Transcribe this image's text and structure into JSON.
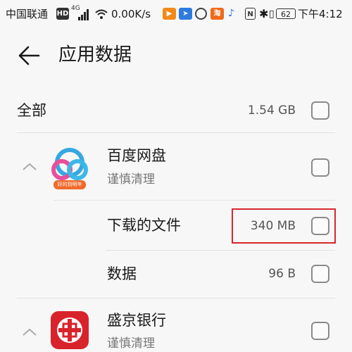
{
  "status_bar": {
    "carrier": "中国联通",
    "hd": "HD",
    "net": "4G",
    "speed": "0.00K/s",
    "icon_badge": "淘",
    "battery": "62",
    "time": "下午4:12"
  },
  "header": {
    "title": "应用数据",
    "back_icon": "arrow-left-icon"
  },
  "colors": {
    "accent_red": "#d8262e",
    "baidu_blue": "#35a8e0",
    "baidu_pink": "#e8509a",
    "shengjing_red": "#d9232b"
  },
  "summary": {
    "label": "全部",
    "size": "1.54 GB"
  },
  "apps": [
    {
      "name": "百度网盘",
      "hint": "谨慎清理",
      "icon": "baidu-netdisk-icon",
      "icon_caption": "好的到明年",
      "items": [
        {
          "label": "下载的文件",
          "size": "340 MB"
        },
        {
          "label": "数据",
          "size": "96 B"
        }
      ]
    },
    {
      "name": "盛京银行",
      "hint": "谨慎清理",
      "icon": "shengjing-bank-icon"
    }
  ]
}
